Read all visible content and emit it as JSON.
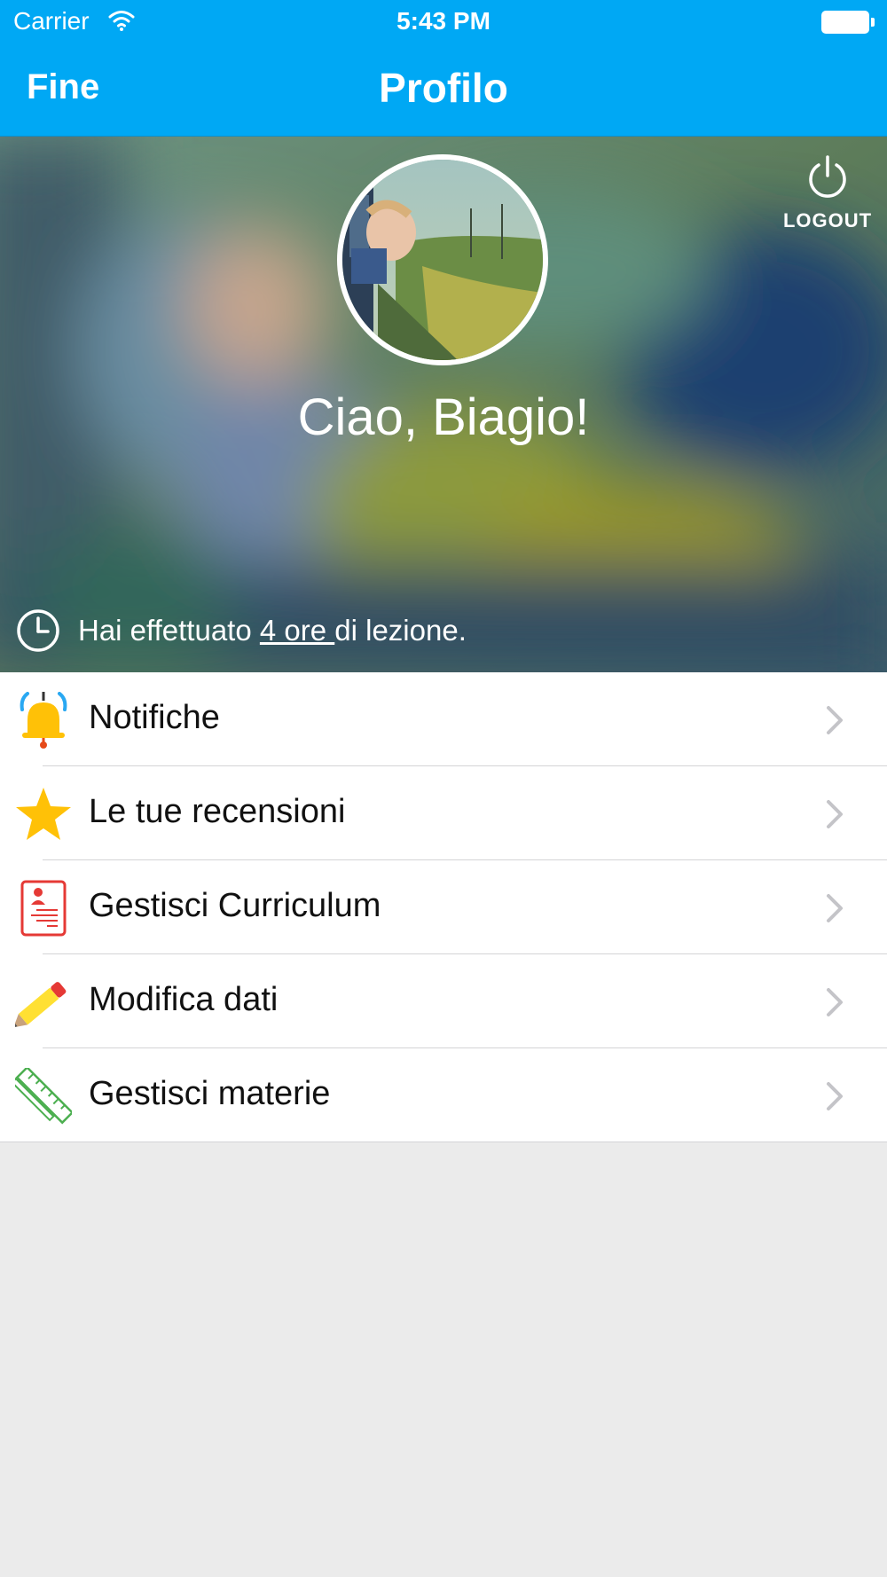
{
  "status_bar": {
    "carrier": "Carrier",
    "time": "5:43 PM"
  },
  "nav": {
    "done_label": "Fine",
    "title": "Profilo"
  },
  "header": {
    "greeting": "Ciao, Biagio!",
    "logout_label": "LOGOUT",
    "hours_prefix": "Hai effettuato ",
    "hours_value": "4 ore ",
    "hours_suffix": "di lezione."
  },
  "menu": {
    "items": [
      {
        "label": "Notifiche",
        "icon": "bell-icon"
      },
      {
        "label": "Le tue recensioni",
        "icon": "star-icon"
      },
      {
        "label": "Gestisci Curriculum",
        "icon": "curriculum-icon"
      },
      {
        "label": "Modifica dati",
        "icon": "pencil-icon"
      },
      {
        "label": "Gestisci materie",
        "icon": "ruler-pencil-icon"
      }
    ]
  },
  "colors": {
    "nav_blue": "#00a8f4",
    "bell_yellow": "#ffc107",
    "star_yellow": "#ffc107",
    "curriculum_red": "#e53935",
    "ruler_green": "#4caf50"
  }
}
